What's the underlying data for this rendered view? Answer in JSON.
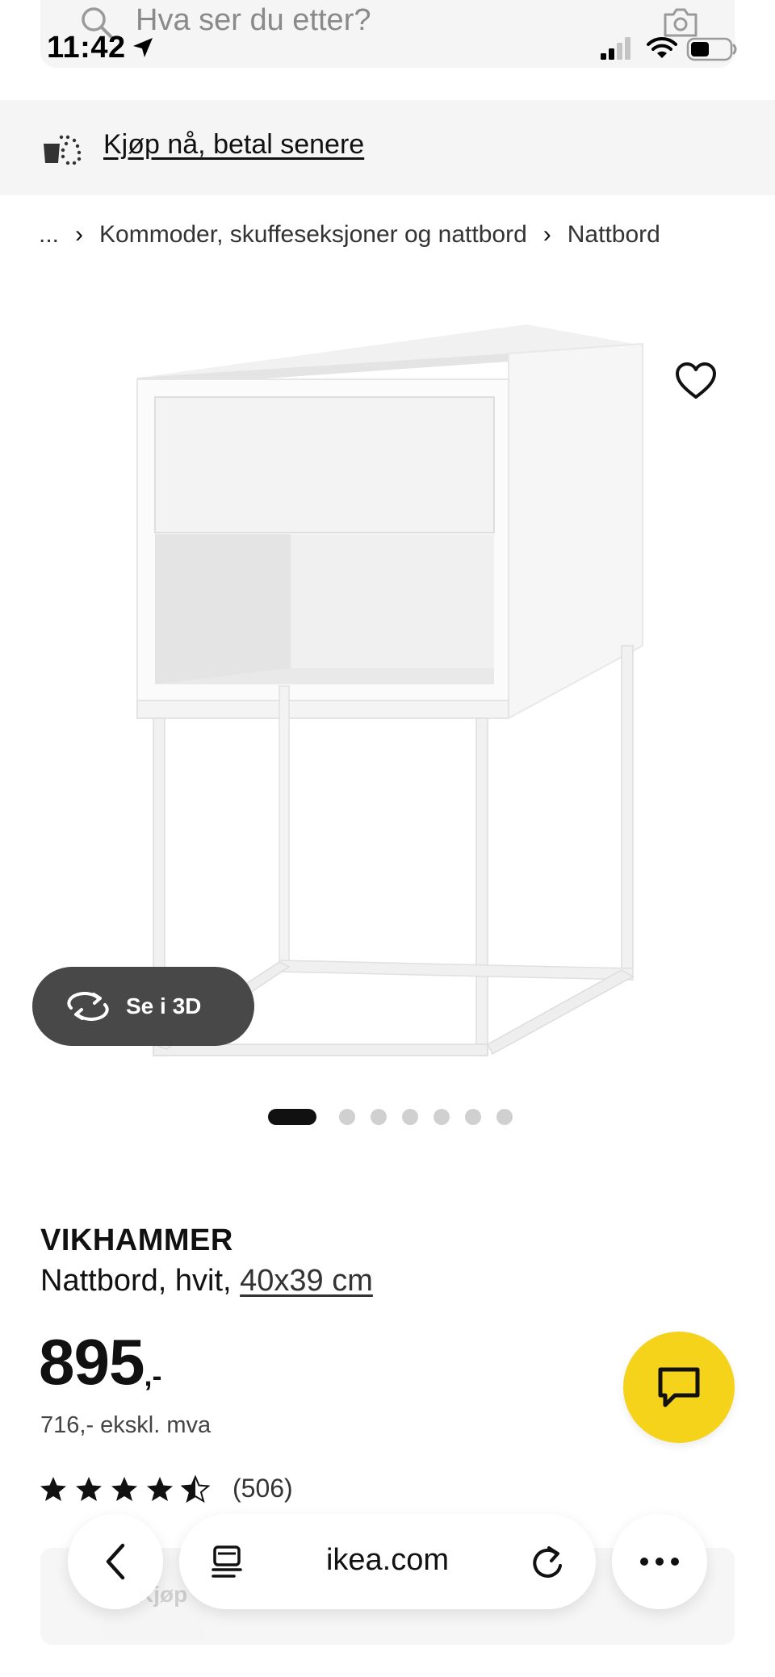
{
  "status_bar": {
    "time": "11:42"
  },
  "search": {
    "placeholder": "Hva ser du etter?"
  },
  "banner": {
    "label": "Kjøp nå, betal senere"
  },
  "breadcrumb": {
    "items": [
      "...",
      "Kommoder, skuffeseksjoner og nattbord",
      "Nattbord"
    ]
  },
  "gallery": {
    "view_3d_label": "Se i 3D",
    "image_count": 7,
    "active_index": 0
  },
  "product": {
    "name": "VIKHAMMER",
    "description": "Nattbord, hvit, ",
    "size": "40x39 cm",
    "price_integer": "895",
    "price_suffix": ",-",
    "price_ex_vat": "716,- ekskl. mva",
    "rating": 4.5,
    "review_count": "(506)"
  },
  "buy_bar": {
    "label": "Kjøp"
  },
  "browser": {
    "url": "ikea.com"
  },
  "colors": {
    "chat_accent": "#f5d31a",
    "view3d_bg": "#484848",
    "banner_bg": "#f5f5f5"
  }
}
